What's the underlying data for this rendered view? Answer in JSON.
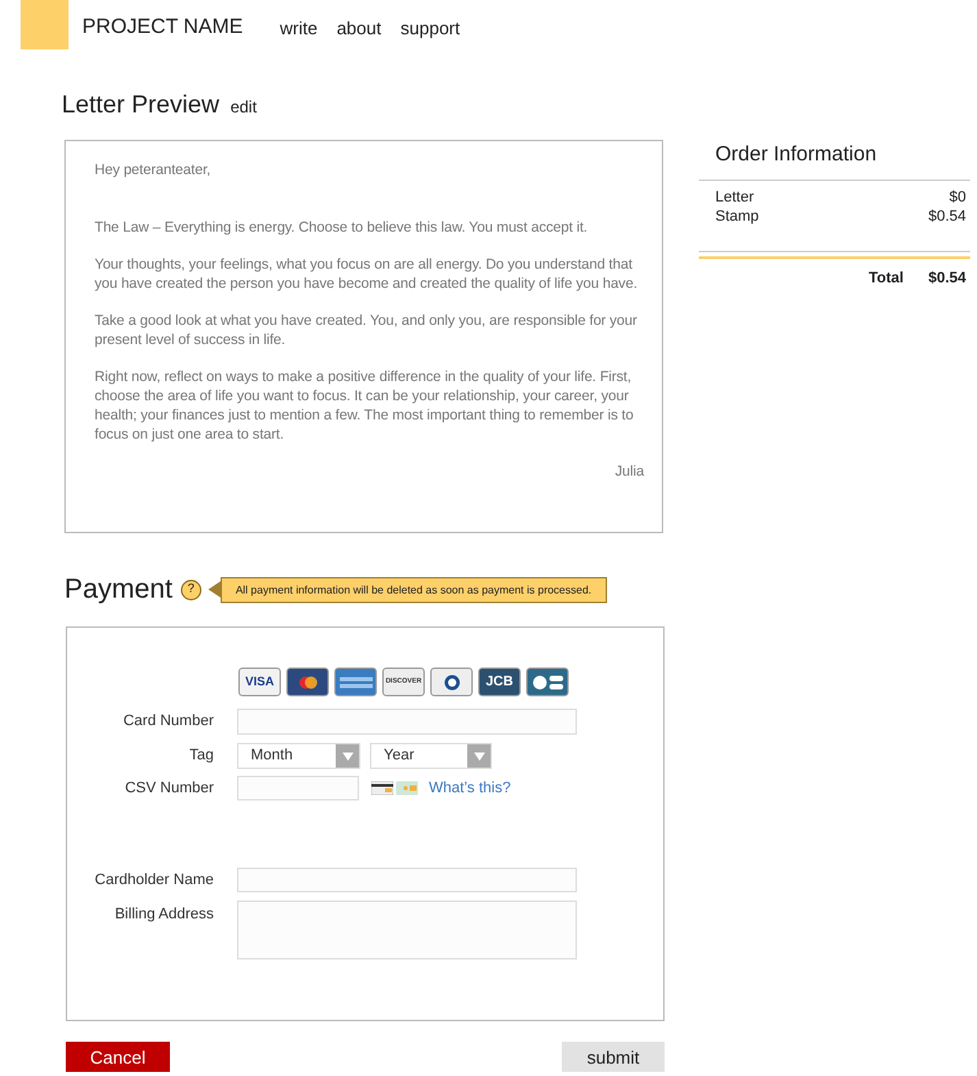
{
  "header": {
    "project_name": "PROJECT NAME",
    "nav": [
      {
        "label": "write"
      },
      {
        "label": "about"
      },
      {
        "label": "support"
      }
    ]
  },
  "letter_preview": {
    "title": "Letter Preview",
    "edit_link": "edit",
    "greeting": "Hey peteranteater,",
    "paragraphs": [
      "The Law – Everything is energy. Choose to believe this law. You must accept it.",
      "Your thoughts, your feelings, what you focus on are all energy. Do you understand that you have created the person you have become and created the quality of life you have.",
      "Take a good look at what you have created. You, and only you, are responsible for your present level of success in life.",
      "Right now, reflect on ways to make a positive difference in the quality of your life. First, choose the area of life you want to focus. It can be your relationship, your career, your health; your finances just to mention a few. The most important thing to remember is to focus on just one area to start."
    ],
    "signature": "Julia"
  },
  "order_information": {
    "title": "Order Information",
    "items": [
      {
        "name": "Letter",
        "price": "$0"
      },
      {
        "name": "Stamp",
        "price": "$0.54"
      }
    ],
    "total_label": "Total",
    "total": "$0.54"
  },
  "payment": {
    "title": "Payment",
    "help_icon": "?",
    "tooltip": "All payment information will be deleted as soon as payment is processed.",
    "cards": [
      {
        "kind": "visa",
        "label": "VISA"
      },
      {
        "kind": "mastercard"
      },
      {
        "kind": "amex"
      },
      {
        "kind": "discover",
        "label": "DISCOVER"
      },
      {
        "kind": "diners"
      },
      {
        "kind": "jcb",
        "label": "JCB"
      },
      {
        "kind": "cb"
      }
    ],
    "card_number_label": "Card Number",
    "tag_label": "Tag",
    "month_select": "Month",
    "year_select": "Year",
    "csv_label": "CSV Number",
    "whats_this_link": "What’s this?",
    "cardholder_label": "Cardholder Name",
    "billing_label": "Billing Address"
  },
  "buttons": {
    "cancel": "Cancel",
    "submit": "submit"
  }
}
